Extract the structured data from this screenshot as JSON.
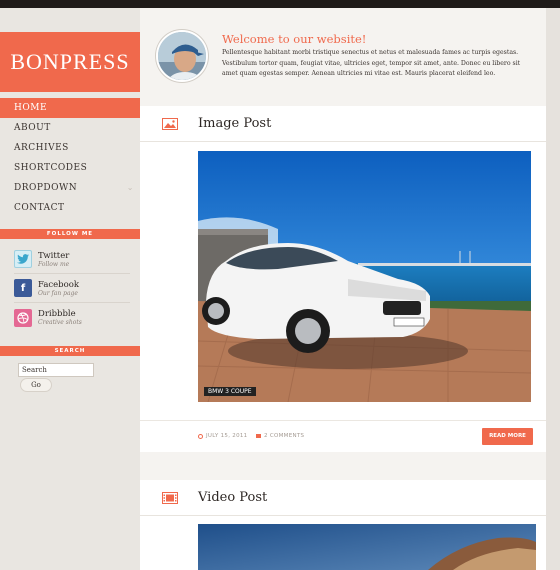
{
  "site": {
    "logo": "BONPRESS",
    "accent": "#f0694c"
  },
  "nav": {
    "items": [
      "HOME",
      "ABOUT",
      "ARCHIVES",
      "SHORTCODES",
      "DROPDOWN",
      "CONTACT"
    ],
    "active_index": 0
  },
  "follow": {
    "title": "FOLLOW ME",
    "items": [
      {
        "name": "Twitter",
        "sub": "Follow me",
        "icon": "twitter-icon"
      },
      {
        "name": "Facebook",
        "sub": "Our fan page",
        "icon": "facebook-icon"
      },
      {
        "name": "Dribbble",
        "sub": "Creative shots",
        "icon": "dribbble-icon"
      }
    ]
  },
  "search": {
    "title": "SEARCH",
    "value": "Search",
    "button": "Go"
  },
  "welcome": {
    "title": "Welcome to our website!",
    "text": "Pellentesque habitant morbi tristique senectus et netus et malesuada fames ac turpis egestas. Vestibulum tortor quam, feugiat vitae, ultricies eget, tempor sit amet, ante. Donec eu libero sit amet quam egestas semper. Aenean ultricies mi vitae est. Mauris placerat eleifend leo."
  },
  "posts": [
    {
      "title": "Image Post",
      "caption": "BMW 3 COUPE",
      "date": "JULY 15, 2011",
      "comments": "2 COMMENTS",
      "read_more": "READ MORE"
    },
    {
      "title": "Video Post"
    }
  ]
}
